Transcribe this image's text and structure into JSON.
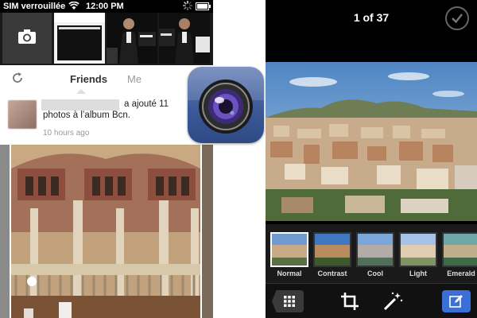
{
  "left_screen": {
    "status_bar": {
      "carrier": "SIM verrouillée",
      "time": "12:00 PM"
    },
    "tabs": {
      "friends": "Friends",
      "me": "Me"
    },
    "story": {
      "text": "a ajouté 11 photos à l’album Bcn.",
      "time": "10 hours ago"
    },
    "icons": {
      "camera": "camera-icon",
      "refresh": "refresh-icon"
    }
  },
  "app_icon": {
    "name": "facebook-camera-app-icon",
    "color": "#3c5a99"
  },
  "right_screen": {
    "counter": "1 of 37",
    "filters": [
      {
        "label": "Normal",
        "selected": true
      },
      {
        "label": "Contrast",
        "selected": false
      },
      {
        "label": "Cool",
        "selected": false
      },
      {
        "label": "Light",
        "selected": false
      },
      {
        "label": "Emerald",
        "selected": false
      }
    ],
    "toolbar": {
      "grid": "grid-icon",
      "crop": "crop-icon",
      "enhance": "magic-wand-icon",
      "edit": "edit-icon"
    },
    "accent_color": "#3a6fd8"
  }
}
